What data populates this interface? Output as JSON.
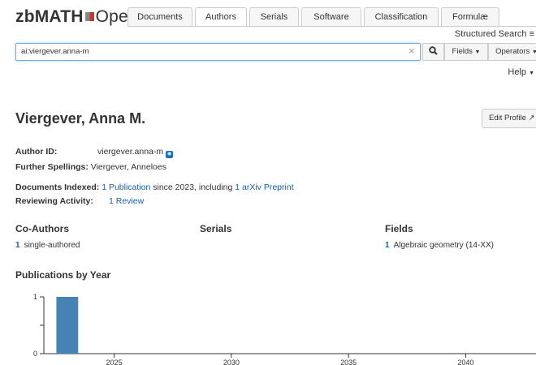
{
  "header": {
    "logo_bold": "zbMATH",
    "logo_light": "Open",
    "tabs": [
      {
        "label": "Documents",
        "active": false
      },
      {
        "label": "Authors",
        "active": true
      },
      {
        "label": "Serials",
        "active": false
      },
      {
        "label": "Software",
        "active": false
      },
      {
        "label": "Classification",
        "active": false
      },
      {
        "label": "Formulæ",
        "active": false
      }
    ],
    "structured_search": "Structured Search"
  },
  "search": {
    "value": "ai:viergever.anna-m",
    "fields_label": "Fields",
    "operators_label": "Operators",
    "help_label": "Help"
  },
  "profile": {
    "name": "Viergever, Anna M.",
    "edit_label": "Edit Profile",
    "author_id_label": "Author ID:",
    "author_id": "viergever.anna-m",
    "spellings_label": "Further Spellings:",
    "spellings": "Viergever, Anneloes",
    "docs_label": "Documents Indexed:",
    "docs_link": "1 Publication",
    "docs_mid": "since 2023, including",
    "docs_link2": "1 arXiv Preprint",
    "reviewing_label": "Reviewing Activity:",
    "reviewing_link": "1 Review"
  },
  "sections": {
    "coauthors_title": "Co-Authors",
    "coauthors_count": "1",
    "coauthors_text": "single-authored",
    "serials_title": "Serials",
    "fields_title": "Fields",
    "fields_count": "1",
    "fields_text": "Algebraic geometry (14-XX)",
    "pubs_title": "Publications by Year"
  },
  "colors": {
    "bar": "#4682b4",
    "link": "#1a5fa8"
  },
  "chart_data": {
    "type": "bar",
    "title": "Publications by Year",
    "x": [
      2023
    ],
    "values": [
      1
    ],
    "xlim": [
      2022,
      2043
    ],
    "ylim": [
      0,
      1
    ],
    "xticks": [
      2025,
      2030,
      2035,
      2040
    ],
    "yticks": [
      0,
      1
    ]
  }
}
